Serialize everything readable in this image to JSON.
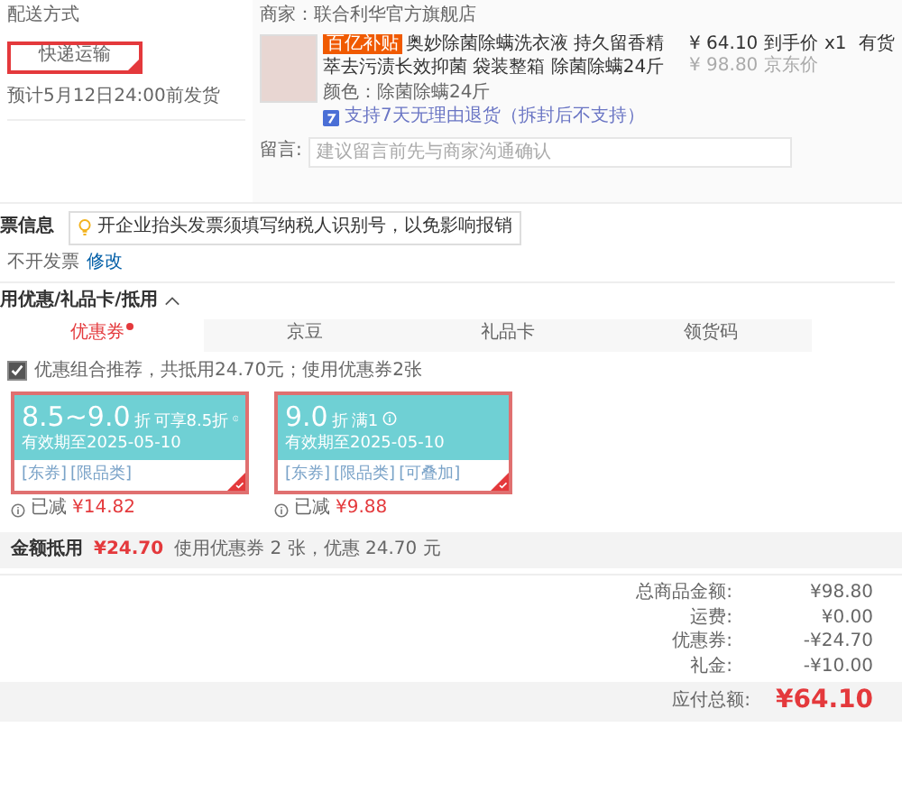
{
  "shipping": {
    "title": "配送方式",
    "options": [
      {
        "label": "快递运输",
        "selected": true
      }
    ],
    "estimate": "预计5月12日24:00前发货"
  },
  "order": {
    "merchant": "商家：联合利华官方旗舰店",
    "product": {
      "badge": "百亿补贴",
      "title_lines": [
        "奥妙除菌除螨洗衣液 持久留香精",
        "萃去污渍长效抑菌 袋装整箱 除菌除螨24斤"
      ],
      "price": "¥ 64.10 到手价",
      "original_price": "¥ 98.80 京东价",
      "quantity": "x1",
      "stock": "有货",
      "variant": "颜色：除菌除螨24斤",
      "return_policy": "支持7天无理由退货（拆封后不支持）"
    },
    "message": {
      "label": "留言:",
      "placeholder": "建议留言前先与商家沟通确认"
    }
  },
  "invoice": {
    "title": "票信息",
    "tip": "开企业抬头发票须填写纳税人识别号，以免影响报销",
    "value": "不开发票",
    "edit_link": "修改"
  },
  "discounts": {
    "title": "用优惠/礼品卡/抵用",
    "expanded": true,
    "tabs": [
      {
        "label": "优惠券",
        "selected": true,
        "dot": true
      },
      {
        "label": "京豆",
        "selected": false,
        "dot": false
      },
      {
        "label": "礼品卡",
        "selected": false,
        "dot": false
      },
      {
        "label": "领货码",
        "selected": false,
        "dot": false
      }
    ],
    "recommend": {
      "checked": true,
      "text": "优惠组合推荐，共抵用24.70元；使用优惠券2张"
    },
    "coupons": [
      {
        "amount": "8.5~9.0",
        "unit": "折",
        "condition": "可享8.5折",
        "validity": "有效期至2025-05-10",
        "tags": [
          "[东券]",
          "[限品类]"
        ],
        "selected": true,
        "saved": "已减",
        "saved_amount": "¥14.82"
      },
      {
        "amount": "9.0",
        "unit": "折",
        "condition": "满1",
        "validity": "有效期至2025-05-10",
        "tags": [
          "[东券]",
          "[限品类]",
          "[可叠加]"
        ],
        "selected": true,
        "saved": "已减",
        "saved_amount": "¥9.88"
      }
    ],
    "summary": {
      "label": "金额抵用",
      "amount": "¥24.70",
      "detail": "使用优惠券 2 张，优惠 24.70 元"
    }
  },
  "totals": {
    "rows": [
      {
        "label": "总商品金额:",
        "value": "¥98.80"
      },
      {
        "label": "运费:",
        "value": "¥0.00"
      },
      {
        "label": "优惠券:",
        "value": "-¥24.70"
      },
      {
        "label": "礼金:",
        "value": "-¥10.00"
      }
    ],
    "payable_label": "应付总额:",
    "payable": "¥64.10"
  }
}
